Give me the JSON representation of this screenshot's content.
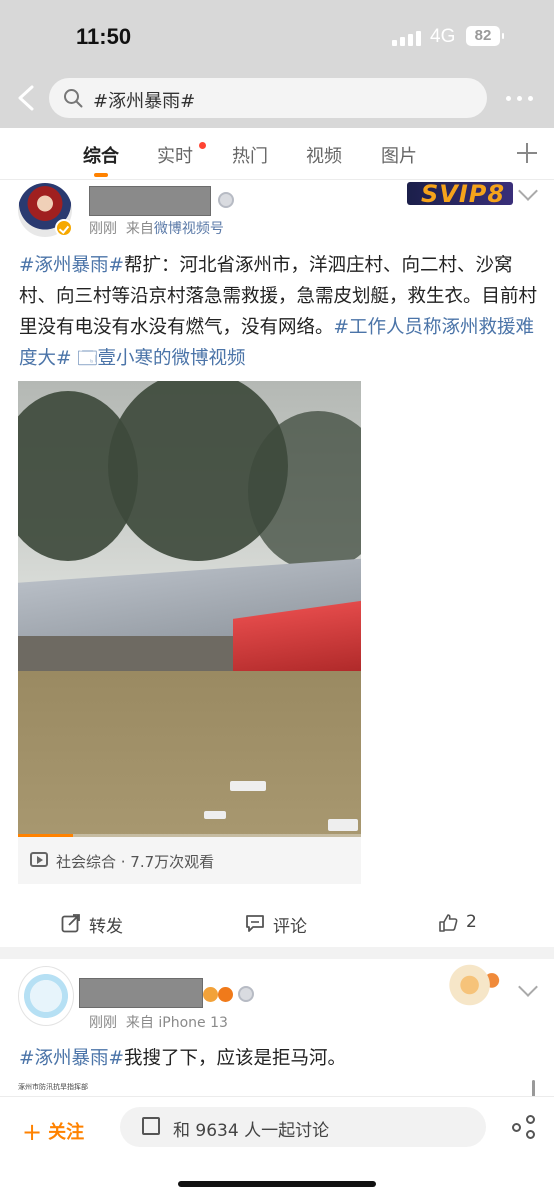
{
  "status_bar": {
    "time": "11:50",
    "network": "4G",
    "battery": "82"
  },
  "search": {
    "query": "#涿州暴雨#"
  },
  "tabs": [
    {
      "label": "综合",
      "active": true
    },
    {
      "label": "实时",
      "has_dot": true
    },
    {
      "label": "热门"
    },
    {
      "label": "视频"
    },
    {
      "label": "图片"
    }
  ],
  "post1": {
    "meta_time": "刚刚",
    "meta_from": "来自",
    "meta_source": "微博视频号",
    "ad_text": "SVIP8",
    "text_tag1": "#涿州暴雨#",
    "text_body": "帮扩：河北省涿州市，洋泗庄村、向二村、沙窝村、向三村等沿京村落急需救援，急需皮划艇，救生衣。目前村里没有电没有水没有燃气，没有网络。",
    "text_tag2": "#工作人员称涿州救援难度大#",
    "text_link": "🗔壹小寒的微博视频",
    "video": {
      "progress_percent": 16
    },
    "video_meta": "社会综合 · 7.7万次观看",
    "actions": {
      "repost": "转发",
      "comment": "评论",
      "like_count": "2"
    }
  },
  "post2": {
    "meta_time": "刚刚",
    "meta_from": "来自",
    "meta_source": "iPhone 13",
    "text_tag": "#涿州暴雨#",
    "text_body": "我搜了下，应该是拒马河。",
    "image_caption": "涿州市防汛抗旱指挥部"
  },
  "bottom_bar": {
    "follow": "关注",
    "discuss": "和 9634 人一起讨论"
  },
  "colors": {
    "accent": "#ff8200",
    "link": "#4b74a8"
  }
}
